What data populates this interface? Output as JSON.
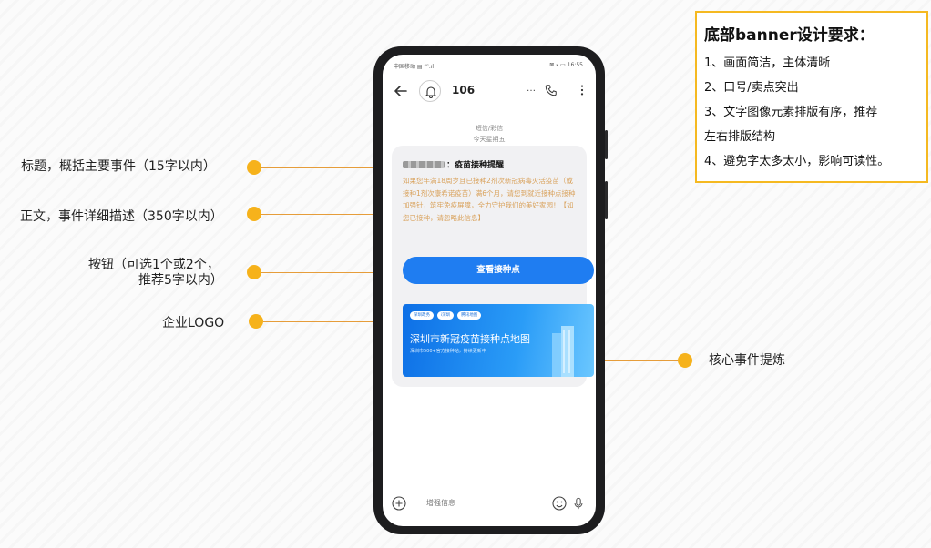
{
  "requirements": {
    "title": "底部banner设计要求：",
    "items": [
      "1、画面简洁，主体清晰",
      "2、口号/卖点突出",
      "3、文字图像元素排版有序，推荐",
      "左右排版结构",
      "4、避免字太多太小，影响可读性。"
    ]
  },
  "annotations": {
    "title": "标题，概括主要事件（15字以内）",
    "body": "正文，事件详细描述（350字以内）",
    "button_line1": "按钮（可选1个或2个，",
    "button_line2": "推荐5字以内）",
    "logo": "企业LOGO",
    "core": "核心事件提炼"
  },
  "phone": {
    "status_left": "中国移动 ▤ ⁴ᴳ.ıl",
    "status_right": "⊠ ⁎ ▭ 16:55",
    "sender": "106",
    "msg_type": "短信/彩信",
    "msg_date": "今天星期五",
    "message": {
      "title": "：疫苗接种提醒",
      "body": "如果您年满18周岁且已接种2剂次新冠病毒灭活疫苗（或接种1剂次康希诺疫苗）满6个月，请您到就近接种点接种加强针，筑牢免疫屏障，全力守护我们的美好家园！【如您已接种，请忽略此信息】",
      "button": "查看接种点"
    },
    "banner": {
      "chips": [
        "深圳政务",
        "i深圳",
        "腾讯地图"
      ],
      "title": "深圳市新冠疫苗接种点地图",
      "subtitle": "深圳市500+官方接种站，持续更新中"
    },
    "input_placeholder": "增强信息"
  },
  "colors": {
    "accent_yellow": "#f6b21b",
    "button_blue": "#1f7df1",
    "body_text": "#d9a25c"
  }
}
